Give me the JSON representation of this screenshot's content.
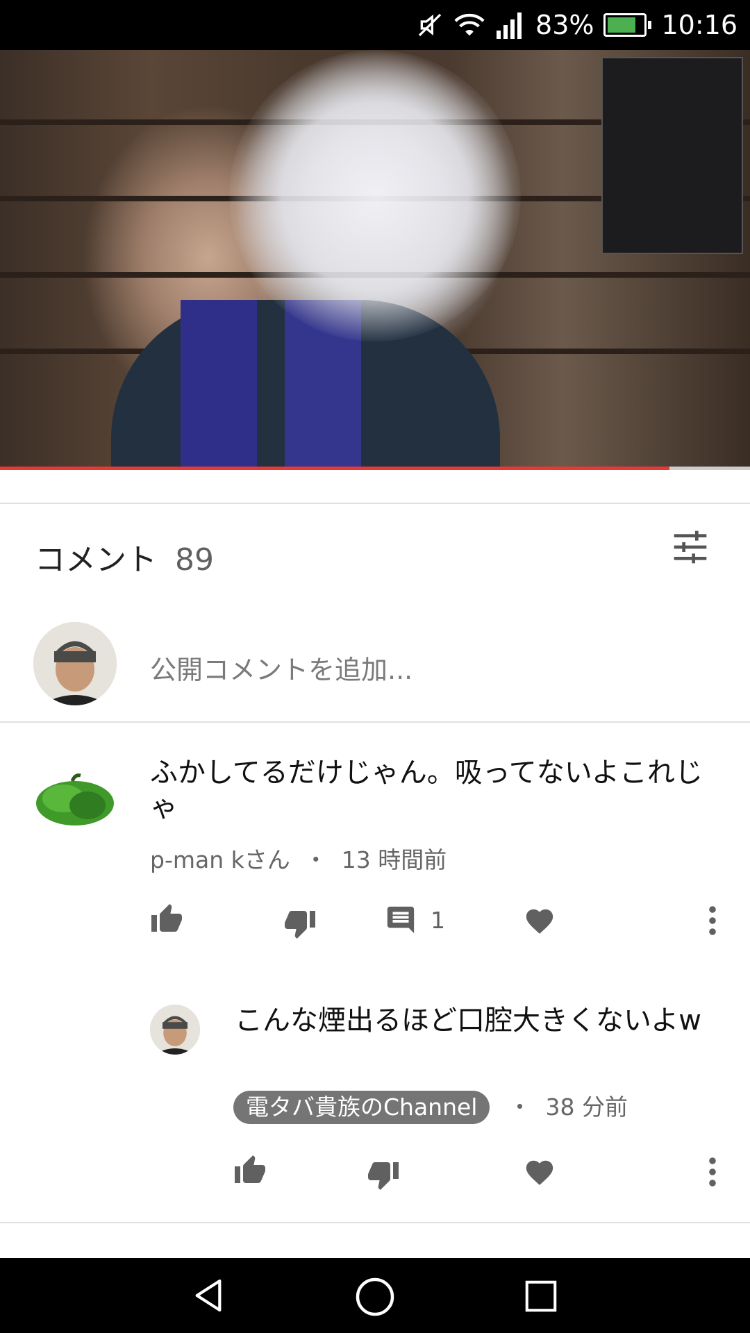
{
  "status_bar": {
    "battery_percent": "83%",
    "time": "10:16",
    "battery_color": "#4caf50"
  },
  "video": {
    "progress": 0.893,
    "progress_color": "#e53935"
  },
  "comments": {
    "title": "コメント",
    "count": "89",
    "add_placeholder": "公開コメントを追加..."
  },
  "comment1": {
    "text": "ふかしてるだけじゃん。吸ってないよこれじゃ",
    "author": "p-man kさん",
    "separator": "・",
    "time": "13 時間前",
    "reply_count": "1"
  },
  "reply1": {
    "text": "こんな煙出るほど口腔大きくないよw",
    "author": "電タバ貴族のChannel",
    "separator": "・",
    "time": "38 分前"
  }
}
